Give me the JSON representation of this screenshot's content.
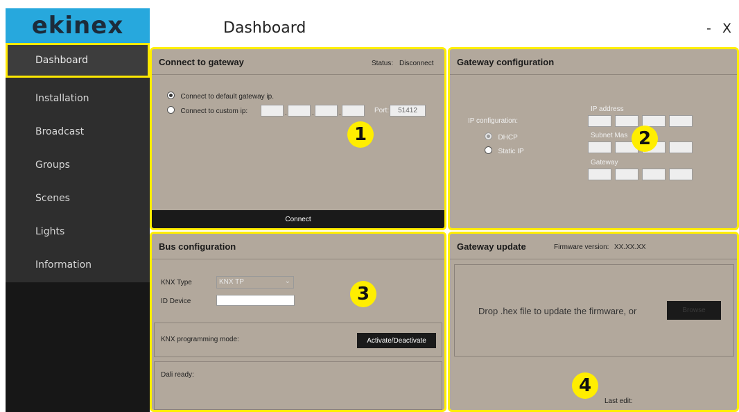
{
  "app": {
    "logo": "ekinex",
    "title": "Dashboard",
    "minimize": "-",
    "close": "X"
  },
  "sidebar": {
    "items": [
      {
        "label": "Dashboard",
        "active": true
      },
      {
        "label": "Installation"
      },
      {
        "label": "Broadcast"
      },
      {
        "label": "Groups"
      },
      {
        "label": "Scenes"
      },
      {
        "label": "Lights"
      },
      {
        "label": "Information"
      }
    ]
  },
  "connect": {
    "title": "Connect to gateway",
    "status_label": "Status:",
    "status_value": "Disconnect",
    "option_default": "Connect to default gateway ip.",
    "option_custom": "Connect to custom ip:",
    "port_label": "Port:",
    "port_value": "51412",
    "button": "Connect",
    "badge": "1"
  },
  "gateway_config": {
    "title": "Gateway configuration",
    "ip_config_label": "IP configuration:",
    "dhcp": "DHCP",
    "static": "Static IP",
    "ip_address_label": "IP address",
    "subnet_label": "Subnet Mas",
    "gateway_label": "Gateway",
    "badge": "2"
  },
  "bus_config": {
    "title": "Bus configuration",
    "knx_type_label": "KNX Type",
    "knx_type_value": "KNX TP",
    "id_device_label": "ID Device",
    "id_device_value": "",
    "prog_mode_label": "KNX programming mode:",
    "prog_button": "Activate/Deactivate",
    "dali_label": "Dali ready:",
    "badge": "3"
  },
  "gateway_update": {
    "title": "Gateway update",
    "firmware_label": "Firmware version:",
    "firmware_value": "XX.XX.XX",
    "drop_text": "Drop .hex file to update the firmware, or",
    "browse": "Browse",
    "last_edit": "Last edit:",
    "badge": "4"
  },
  "colors": {
    "accent": "#ffee00",
    "logo_bg": "#27a8dd",
    "panel_bg": "#b2a89c",
    "sidebar_bg": "#2e2e2e"
  }
}
